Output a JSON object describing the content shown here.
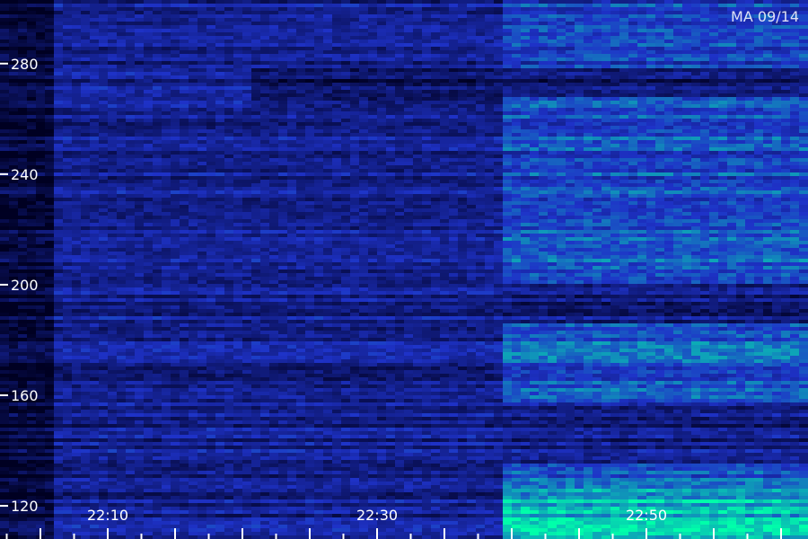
{
  "chart_data": {
    "type": "heatmap",
    "title": "",
    "xlabel": "",
    "ylabel": "",
    "station_label": "MA 09/14",
    "x_tick_labels": [
      "22:10",
      "22:30",
      "22:50"
    ],
    "x_tick_minutes": [
      10,
      30,
      50
    ],
    "x_range_minutes": [
      2,
      62
    ],
    "y_ticks": [
      120,
      160,
      200,
      240,
      280
    ],
    "y_tick_labels": [
      "120",
      "160",
      "200",
      "240",
      "280"
    ],
    "ylim": [
      108,
      303
    ],
    "colors": {
      "background": "#000000",
      "low": "#000022",
      "mid": "#1e32c8",
      "high": "#00ffaa",
      "text": "#ffffff"
    }
  }
}
